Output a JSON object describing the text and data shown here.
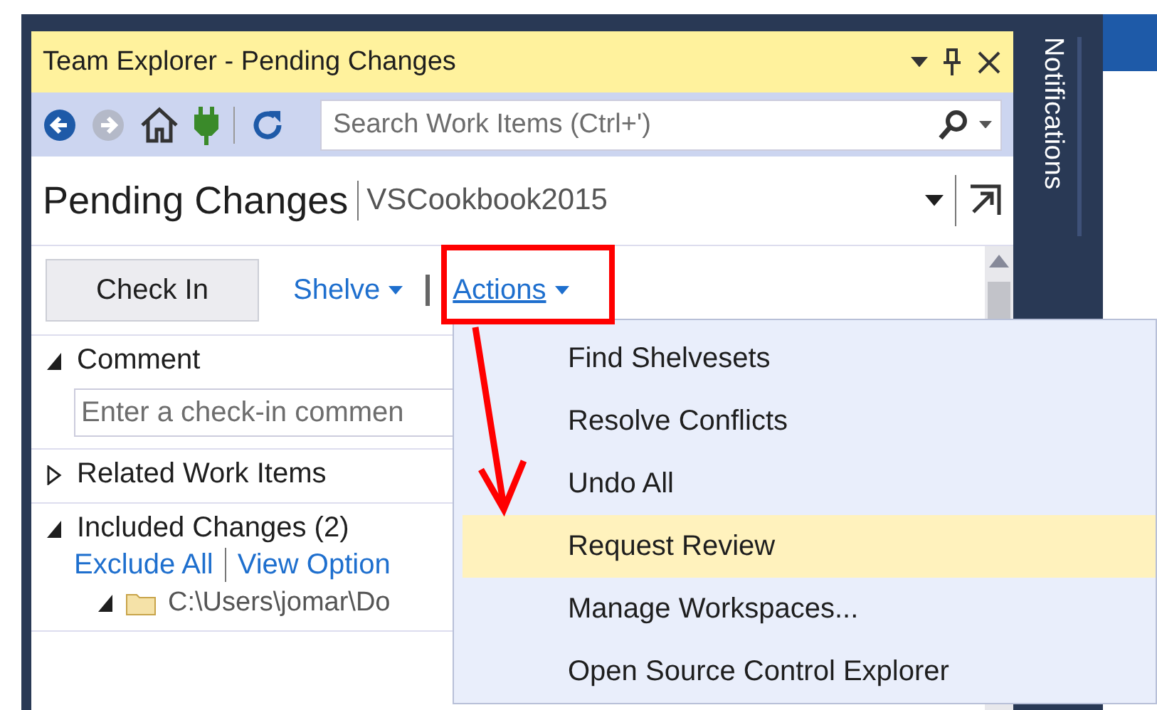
{
  "window": {
    "title": "Team Explorer - Pending Changes"
  },
  "toolbar": {
    "search": {
      "placeholder": "Search Work Items (Ctrl+')"
    }
  },
  "side_tab": {
    "label": "Notifications"
  },
  "header": {
    "title": "Pending Changes",
    "project": "VSCookbook2015"
  },
  "commands": {
    "check_in": "Check In",
    "links": [
      {
        "label": "Shelve",
        "expanded": false
      },
      {
        "label": "Actions",
        "expanded": true
      }
    ]
  },
  "sections": [
    {
      "kind": "comment",
      "title": "Comment",
      "expanded": true,
      "placeholder": "Enter a check-in commen"
    },
    {
      "kind": "plain",
      "title": "Related Work Items",
      "expanded": false
    },
    {
      "kind": "changes",
      "title": "Included Changes (2)",
      "expanded": true,
      "links": [
        "Exclude All",
        "View Option"
      ],
      "items": [
        {
          "label": "C:\\Users\\jomar\\Do",
          "expanded": true
        }
      ]
    }
  ],
  "menu": {
    "items": [
      {
        "label": "Find Shelvesets",
        "selected": false
      },
      {
        "label": "Resolve Conflicts",
        "selected": false
      },
      {
        "label": "Undo All",
        "selected": false
      },
      {
        "label": "Request Review",
        "selected": true
      },
      {
        "label": "Manage Workspaces...",
        "selected": false
      },
      {
        "label": "Open Source Control Explorer",
        "selected": false
      }
    ]
  }
}
